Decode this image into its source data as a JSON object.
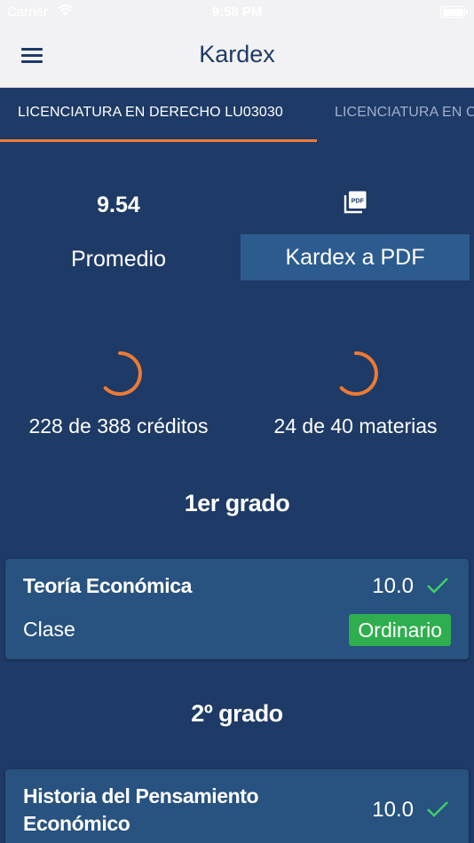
{
  "status_bar": {
    "carrier": "Carrier",
    "time": "9:58 PM"
  },
  "nav": {
    "title": "Kardex",
    "menu_icon": "hamburger-menu-icon"
  },
  "tabs": [
    {
      "label": "LICENCIATURA EN DERECHO  LU03030",
      "selected": true
    },
    {
      "label": "LICENCIATURA EN C",
      "selected": false
    }
  ],
  "summary": {
    "average_value": "9.54",
    "average_label": "Promedio",
    "pdf_icon": "pdf-file-icon",
    "pdf_button_label": "Kardex a PDF",
    "credits_label": "228 de 388 créditos",
    "credits_progress": 0.59,
    "subjects_label": "24 de 40 materias",
    "subjects_progress": 0.6
  },
  "grades": [
    {
      "title": "1er grado",
      "courses": [
        {
          "name": "Teoría Económica",
          "grade": "10.0",
          "type": "Clase",
          "status": "Ordinario"
        }
      ]
    },
    {
      "title": "2º grado",
      "courses": [
        {
          "name": "Historia del Pensamiento Económico",
          "grade": "10.0"
        }
      ]
    }
  ],
  "colors": {
    "background": "#1e3a66",
    "accent": "#ee7a35",
    "card": "#28527f",
    "button": "#2c5c8f",
    "success": "#2fae4f",
    "check": "#3fcf6a"
  }
}
